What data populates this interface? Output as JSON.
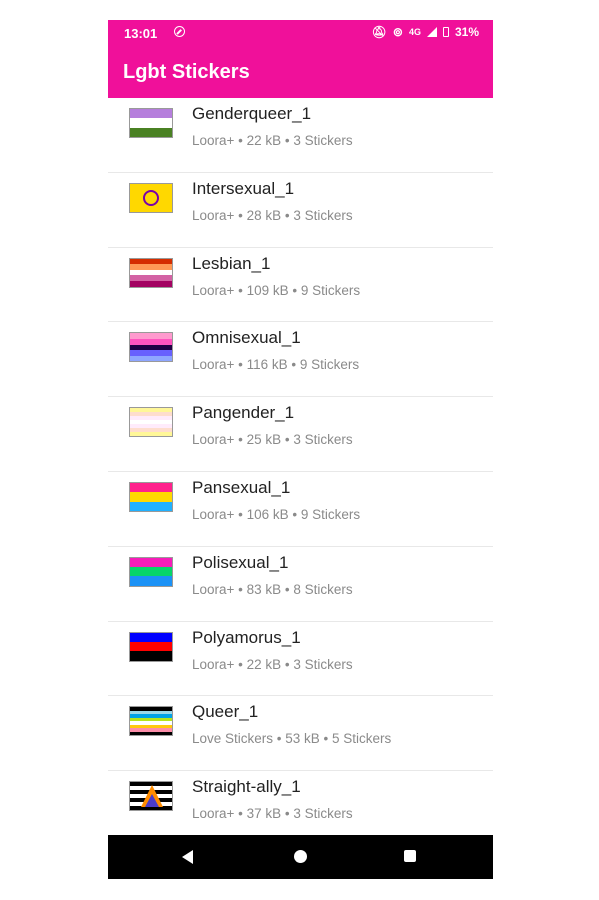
{
  "status": {
    "time": "13:01",
    "network": "4G",
    "battery": "31%"
  },
  "appbar": {
    "title": "Lgbt Stickers"
  },
  "packs": [
    {
      "name": "Genderqueer_1",
      "meta": "Loora+ • 22 kB • 3 Stickers",
      "flag": [
        "#b57edc",
        "#ffffff",
        "#4a8123"
      ]
    },
    {
      "name": "Intersexual_1",
      "meta": "Loora+ • 28 kB • 3 Stickers",
      "flag": [
        "#ffd800"
      ]
    },
    {
      "name": "Lesbian_1",
      "meta": "Loora+ • 109 kB • 9 Stickers",
      "flag": [
        "#d52d00",
        "#ff9a56",
        "#ffffff",
        "#d362a4",
        "#a30262"
      ]
    },
    {
      "name": "Omnisexual_1",
      "meta": "Loora+ • 116 kB • 9 Stickers",
      "flag": [
        "#fe9ace",
        "#ff53bf",
        "#200044",
        "#6760fe",
        "#8ea6ff"
      ]
    },
    {
      "name": "Pangender_1",
      "meta": "Loora+ • 25 kB • 3 Stickers",
      "flag": [
        "#fff798",
        "#fedDcd",
        "#ffebfb",
        "#ffffff",
        "#ffebfb",
        "#fedDcd",
        "#fff798"
      ]
    },
    {
      "name": "Pansexual_1",
      "meta": "Loora+ • 106 kB • 9 Stickers",
      "flag": [
        "#ff218c",
        "#ffd800",
        "#21b1ff"
      ]
    },
    {
      "name": "Polisexual_1",
      "meta": "Loora+ • 83 kB • 8 Stickers",
      "flag": [
        "#f61cb9",
        "#07d569",
        "#1c92f6"
      ]
    },
    {
      "name": "Polyamorus_1",
      "meta": "Loora+ • 22 kB • 3 Stickers",
      "flag": [
        "#0000ff",
        "#ff0000",
        "#000000"
      ]
    },
    {
      "name": "Queer_1",
      "meta": "Love Stickers • 53 kB • 5 Stickers",
      "flag": [
        "#000000",
        "#9ad9eb",
        "#00a3e8",
        "#b5e51d",
        "#ffffff",
        "#ffc90e",
        "#fc8da9",
        "#000000"
      ]
    },
    {
      "name": "Straight-ally_1",
      "meta": "Loora+ • 37 kB • 3 Stickers",
      "flag": [
        "#000000",
        "#ffffff",
        "#000000",
        "#ffffff",
        "#000000",
        "#ffffff",
        "#000000"
      ]
    }
  ],
  "colors": {
    "brand": "#f0109a"
  }
}
